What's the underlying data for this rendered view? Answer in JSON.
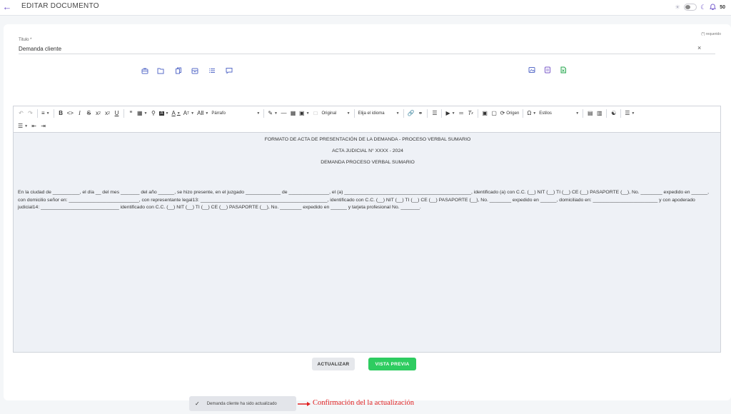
{
  "header": {
    "title": "EDITAR DOCUMENTO",
    "notifications_count": "50"
  },
  "form": {
    "required_note": "(*) requerido",
    "title_label": "Titulo *",
    "title_value": "Demanda cliente",
    "clear_symbol": "×"
  },
  "editor": {
    "toolbar": {
      "paragraph": "Párrafo",
      "original": "Original",
      "language": "Elija el idioma",
      "source": "Origen",
      "styles": "Estilos"
    },
    "document": {
      "heading1": "FORMATO DE ACTA DE PRESENTACIÓN DE LA DEMANDA - PROCESO VERBAL SUMARIO",
      "heading2": "ACTA JUDICIAL N° XXXX - 2024",
      "heading3": "DEMANDA PROCESO VERBAL SUMARIO",
      "paragraph": "En la ciudad de __________, el día __ del mes _______ del año ______, se hizo presente, en el juzgado _____________ de _______________, el (a) _______________________________________________, identificado (a) con C.C. (__) NIT (__) TI (__) CE (__) PASAPORTE (__), No. ________ expedido en ______, con domicilio señor en: __________________________, con representante legal13: _______________________________________________, identificado con C.C. (__) NIT (__) TI (__) CE (__) PASAPORTE (__), No. ________ expedido en ______, domiciliado en: ________________________ y con apoderado judicial14: _____________________________ identificado con C.C. (__) NIT (__) TI (__) CE (__) PASAPORTE (__), No. ________ expedido en ______ y tarjeta profesional No. _______."
    }
  },
  "actions": {
    "update_label": "ACTUALIZAR",
    "preview_label": "VISTA PREVIA"
  },
  "toast": {
    "message": "Demanda cliente ha sido actualizado"
  },
  "annotation": {
    "text": "Confirmación del  la actualización"
  },
  "colors": {
    "accent": "#6b4fc9",
    "icon_blue": "#5a6ec9",
    "preview_green": "#2ecc60",
    "annotation_red": "#e02020"
  }
}
